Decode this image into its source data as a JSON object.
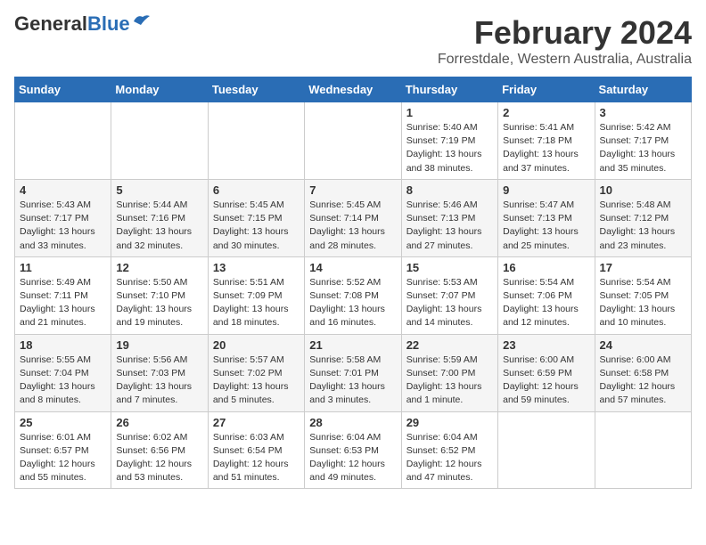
{
  "header": {
    "logo_general": "General",
    "logo_blue": "Blue",
    "month": "February 2024",
    "location": "Forrestdale, Western Australia, Australia"
  },
  "weekdays": [
    "Sunday",
    "Monday",
    "Tuesday",
    "Wednesday",
    "Thursday",
    "Friday",
    "Saturday"
  ],
  "weeks": [
    [
      {
        "day": "",
        "info": ""
      },
      {
        "day": "",
        "info": ""
      },
      {
        "day": "",
        "info": ""
      },
      {
        "day": "",
        "info": ""
      },
      {
        "day": "1",
        "info": "Sunrise: 5:40 AM\nSunset: 7:19 PM\nDaylight: 13 hours\nand 38 minutes."
      },
      {
        "day": "2",
        "info": "Sunrise: 5:41 AM\nSunset: 7:18 PM\nDaylight: 13 hours\nand 37 minutes."
      },
      {
        "day": "3",
        "info": "Sunrise: 5:42 AM\nSunset: 7:17 PM\nDaylight: 13 hours\nand 35 minutes."
      }
    ],
    [
      {
        "day": "4",
        "info": "Sunrise: 5:43 AM\nSunset: 7:17 PM\nDaylight: 13 hours\nand 33 minutes."
      },
      {
        "day": "5",
        "info": "Sunrise: 5:44 AM\nSunset: 7:16 PM\nDaylight: 13 hours\nand 32 minutes."
      },
      {
        "day": "6",
        "info": "Sunrise: 5:45 AM\nSunset: 7:15 PM\nDaylight: 13 hours\nand 30 minutes."
      },
      {
        "day": "7",
        "info": "Sunrise: 5:45 AM\nSunset: 7:14 PM\nDaylight: 13 hours\nand 28 minutes."
      },
      {
        "day": "8",
        "info": "Sunrise: 5:46 AM\nSunset: 7:13 PM\nDaylight: 13 hours\nand 27 minutes."
      },
      {
        "day": "9",
        "info": "Sunrise: 5:47 AM\nSunset: 7:13 PM\nDaylight: 13 hours\nand 25 minutes."
      },
      {
        "day": "10",
        "info": "Sunrise: 5:48 AM\nSunset: 7:12 PM\nDaylight: 13 hours\nand 23 minutes."
      }
    ],
    [
      {
        "day": "11",
        "info": "Sunrise: 5:49 AM\nSunset: 7:11 PM\nDaylight: 13 hours\nand 21 minutes."
      },
      {
        "day": "12",
        "info": "Sunrise: 5:50 AM\nSunset: 7:10 PM\nDaylight: 13 hours\nand 19 minutes."
      },
      {
        "day": "13",
        "info": "Sunrise: 5:51 AM\nSunset: 7:09 PM\nDaylight: 13 hours\nand 18 minutes."
      },
      {
        "day": "14",
        "info": "Sunrise: 5:52 AM\nSunset: 7:08 PM\nDaylight: 13 hours\nand 16 minutes."
      },
      {
        "day": "15",
        "info": "Sunrise: 5:53 AM\nSunset: 7:07 PM\nDaylight: 13 hours\nand 14 minutes."
      },
      {
        "day": "16",
        "info": "Sunrise: 5:54 AM\nSunset: 7:06 PM\nDaylight: 13 hours\nand 12 minutes."
      },
      {
        "day": "17",
        "info": "Sunrise: 5:54 AM\nSunset: 7:05 PM\nDaylight: 13 hours\nand 10 minutes."
      }
    ],
    [
      {
        "day": "18",
        "info": "Sunrise: 5:55 AM\nSunset: 7:04 PM\nDaylight: 13 hours\nand 8 minutes."
      },
      {
        "day": "19",
        "info": "Sunrise: 5:56 AM\nSunset: 7:03 PM\nDaylight: 13 hours\nand 7 minutes."
      },
      {
        "day": "20",
        "info": "Sunrise: 5:57 AM\nSunset: 7:02 PM\nDaylight: 13 hours\nand 5 minutes."
      },
      {
        "day": "21",
        "info": "Sunrise: 5:58 AM\nSunset: 7:01 PM\nDaylight: 13 hours\nand 3 minutes."
      },
      {
        "day": "22",
        "info": "Sunrise: 5:59 AM\nSunset: 7:00 PM\nDaylight: 13 hours\nand 1 minute."
      },
      {
        "day": "23",
        "info": "Sunrise: 6:00 AM\nSunset: 6:59 PM\nDaylight: 12 hours\nand 59 minutes."
      },
      {
        "day": "24",
        "info": "Sunrise: 6:00 AM\nSunset: 6:58 PM\nDaylight: 12 hours\nand 57 minutes."
      }
    ],
    [
      {
        "day": "25",
        "info": "Sunrise: 6:01 AM\nSunset: 6:57 PM\nDaylight: 12 hours\nand 55 minutes."
      },
      {
        "day": "26",
        "info": "Sunrise: 6:02 AM\nSunset: 6:56 PM\nDaylight: 12 hours\nand 53 minutes."
      },
      {
        "day": "27",
        "info": "Sunrise: 6:03 AM\nSunset: 6:54 PM\nDaylight: 12 hours\nand 51 minutes."
      },
      {
        "day": "28",
        "info": "Sunrise: 6:04 AM\nSunset: 6:53 PM\nDaylight: 12 hours\nand 49 minutes."
      },
      {
        "day": "29",
        "info": "Sunrise: 6:04 AM\nSunset: 6:52 PM\nDaylight: 12 hours\nand 47 minutes."
      },
      {
        "day": "",
        "info": ""
      },
      {
        "day": "",
        "info": ""
      }
    ]
  ]
}
